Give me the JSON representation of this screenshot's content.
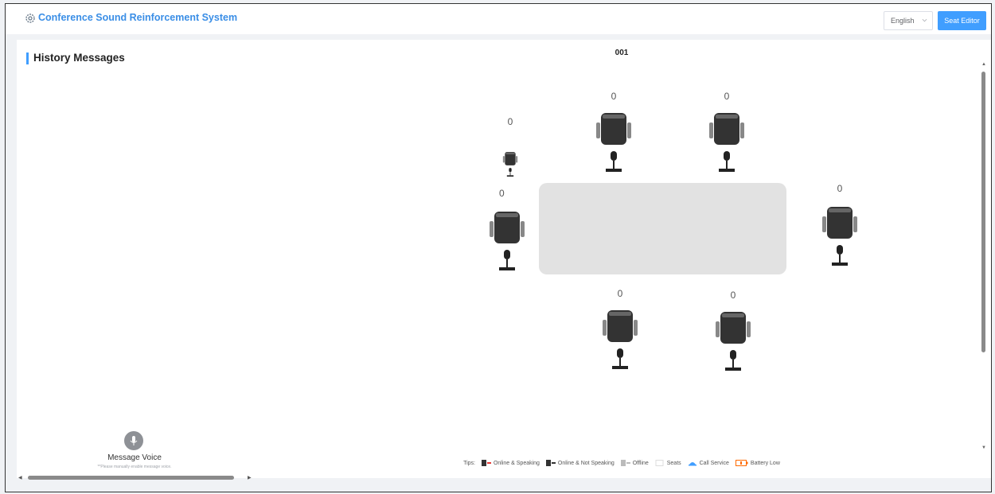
{
  "app": {
    "title": "Conference Sound Reinforcement System",
    "logo_icon": "gear-icon"
  },
  "header": {
    "language": "English",
    "seat_editor_label": "Seat Editor"
  },
  "history": {
    "title": "History Messages",
    "message_voice_label": "Message Voice",
    "message_voice_note": "**Please manually enable message voice."
  },
  "room": {
    "id": "001",
    "seats": [
      {
        "count": "0"
      },
      {
        "count": "0"
      },
      {
        "count": "0"
      },
      {
        "count": "0"
      },
      {
        "count": "0"
      },
      {
        "count": "0"
      },
      {
        "count": "0"
      }
    ]
  },
  "legend": {
    "tips_label": "Tips:",
    "items": [
      {
        "label": "Online & Speaking",
        "icon": "mic-online-speaking-icon"
      },
      {
        "label": "Online & Not Speaking",
        "icon": "mic-online-icon"
      },
      {
        "label": "Offline",
        "icon": "mic-offline-icon"
      },
      {
        "label": "Seats",
        "icon": "seat-outline-icon"
      },
      {
        "label": "Call Service",
        "icon": "call-service-icon"
      },
      {
        "label": "Battery Low",
        "icon": "battery-low-icon"
      }
    ]
  },
  "colors": {
    "accent": "#409eff",
    "title": "#3a8ee6",
    "battery": "#ff6a00"
  }
}
